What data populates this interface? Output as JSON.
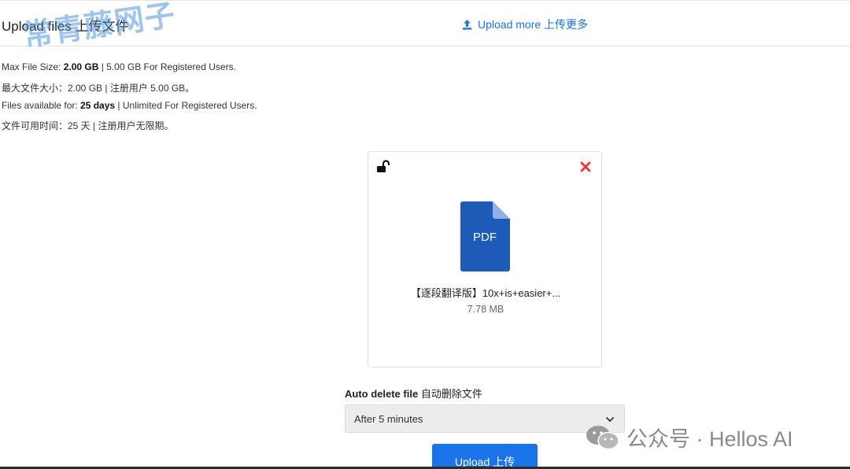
{
  "header": {
    "title": "Upload files 上传文件",
    "watermark": "常青藤网子",
    "upload_more": "Upload more  上传更多"
  },
  "info": {
    "line1_prefix": "Max File Size: ",
    "line1_bold": "2.00 GB",
    "line1_suffix": " | 5.00 GB For Registered Users.",
    "line2": "最大文件大小：2.00 GB | 注册用户 5.00 GB。",
    "line3_prefix": "Files available for: ",
    "line3_bold": "25 days",
    "line3_suffix": " | Unlimited For Registered Users.",
    "line4": "文件可用时间：25 天 | 注册用户无限期。"
  },
  "file": {
    "type_label": "PDF",
    "name": "【逐段翻译版】10x+is+easier+...",
    "size": "7.78 MB"
  },
  "auto_delete": {
    "label_en": "Auto delete file",
    "label_cn": "自动删除文件",
    "selected": "After 5 minutes"
  },
  "upload_button": "Upload  上传",
  "wechat_watermark": "公众号 · Hellos AI",
  "colors": {
    "accent": "#1a73e8",
    "pdf_blue": "#1e5bb8",
    "close_red": "#e53935"
  }
}
